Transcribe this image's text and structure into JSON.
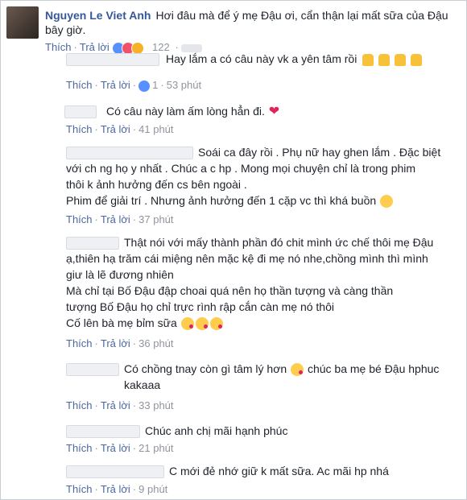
{
  "post": {
    "author": "Nguyen Le Viet Anh",
    "text": "Hơi đâu mà để ý mẹ Đậu ơi, cẩn thận lại mất sữa của Đậu bây giờ.",
    "like_label": "Thích",
    "reply_label": "Trả lời",
    "reaction_count": "122",
    "reactions": [
      "like-icon",
      "love-icon",
      "haha-icon"
    ]
  },
  "replies": [
    {
      "text": "Hay lắm a có câu này vk a yên tâm rồi",
      "emoji": [
        "thumbs-up-icon",
        "thumbs-up-icon",
        "thumbs-up-icon",
        "thumbs-up-icon"
      ],
      "like_label": "Thích",
      "reply_label": "Trả lời",
      "likes": "1",
      "time": "53 phút"
    },
    {
      "text": "Có câu này làm ấm lòng hẳn đi.",
      "emoji": [
        "heart-icon"
      ],
      "like_label": "Thích",
      "reply_label": "Trả lời",
      "time": "41 phút"
    },
    {
      "text": "Soái ca đây rồi . Phụ nữ hay ghen lắm . Đặc biệt với ch ng họ y nhất . Chúc a c hp . Mong mọi chuyện chỉ là trong phim thôi k ảnh hưởng đến cs bên ngoài . Phim để giải trí . Nhưng ảnh hưởng đến 1 cặp vc thì khá buồn",
      "emoji": [
        "sad-face-icon"
      ],
      "like_label": "Thích",
      "reply_label": "Trả lời",
      "time": "37 phút"
    },
    {
      "text": "Thật nói với mấy thành phần đó chit mình ức chế thôi mẹ Đậu ạ,thiên hạ trăm cái miệng nên mặc kệ đi mẹ nó nhe,chồng mình thì mình giư là lẽ đương nhiên Mà chỉ tại Bố Đậu đập choai quá nên họ thần tượng và càng thần tượng Bố Đậu họ chỉ trực rình rập cắn càn mẹ nó thôi Cố lên bà mẹ bỉm sữa",
      "emoji": [
        "kiss-face-icon",
        "kiss-face-icon",
        "kiss-face-icon"
      ],
      "like_label": "Thích",
      "reply_label": "Trả lời",
      "time": "36 phút"
    },
    {
      "text": "Có chồng tnay còn gì tâm lý hơn",
      "text2": "chúc ba mẹ bé Đậu hphuc kakaaa",
      "emoji": [
        "kiss-face-icon"
      ],
      "like_label": "Thích",
      "reply_label": "Trả lời",
      "time": "33 phút"
    },
    {
      "text": "Chúc anh chị mãi hạnh phúc",
      "like_label": "Thích",
      "reply_label": "Trả lời",
      "time": "21 phút"
    },
    {
      "text": "C mới đẻ nhớ giữ k mất sữa. Ac mãi hp nhá",
      "like_label": "Thích",
      "reply_label": "Trả lời",
      "time": "9 phút"
    }
  ],
  "reply3_lines": [
    "Soái ca đây rồi . Phụ nữ hay ghen lắm . Đặc biệt",
    "với ch ng họ y nhất . Chúc a c hp . Mong mọi chuyện chỉ là trong phim",
    "thôi k ảnh hưởng đến cs bên ngoài .",
    "Phim để giải trí . Nhưng ảnh hưởng đến 1 cặp vc thì khá buồn"
  ],
  "reply4_lines": [
    "Thật nói với mấy thành phần đó chit mình ức chế thôi mẹ Đậu",
    "ạ,thiên hạ trăm cái miệng nên mặc kệ đi mẹ nó nhe,chồng mình thì mình",
    "giư là lẽ đương nhiên",
    "Mà chỉ tại Bố Đậu đập choai quá nên họ thần tượng và càng thần",
    "tượng Bố Đậu họ chỉ trực rình rập cắn càn mẹ nó thôi",
    "Cố lên bà mẹ bỉm sữa"
  ]
}
